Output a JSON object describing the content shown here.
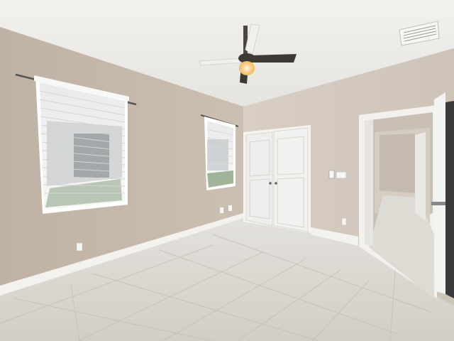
{
  "scene": {
    "description_free": true,
    "colors": {
      "ceiling": "#ecebe8",
      "wall_left": "#c9bdb0",
      "wall_back": "#d6ccc0",
      "wall_right": "#d4cabe",
      "floor": "#d9d6d0",
      "trim": "#f4f3f0",
      "door": "#f2f2f0",
      "hallway": "#ccc3b8",
      "fan_blade": "#f1f0ec",
      "fan_light": "#f6c46b"
    }
  }
}
